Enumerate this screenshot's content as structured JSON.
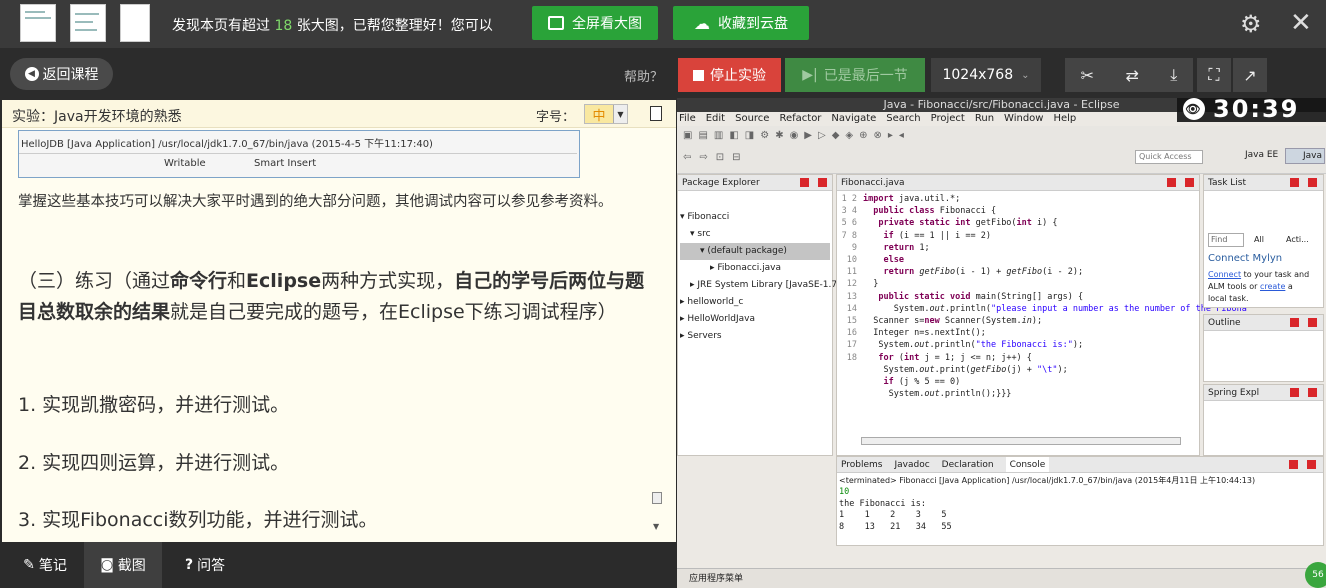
{
  "topbar": {
    "notice_pre": "发现本页有超过",
    "notice_num": "18",
    "notice_post": "张大图，已帮您整理好！您可以",
    "fullscreen_btn": "全屏看大图",
    "cloud_btn": "收藏到云盘"
  },
  "toolbar": {
    "back": "返回课程",
    "help": "帮助？",
    "stop": "停止实验",
    "last": "已是最后一节",
    "resolution": "1024x768"
  },
  "doc": {
    "title": "实验：Java开发环境的熟悉",
    "font_label": "字号：",
    "font_value": "中",
    "mini_console": "HelloJDB [Java Application] /usr/local/jdk1.7.0_67/bin/java (2015-4-5 下午11:17:40)",
    "mini_writable": "Writable",
    "mini_insert": "Smart Insert",
    "para1": "掌握这些基本技巧可以解决大家平时遇到的绝大部分问题，其他调试内容可以参见参考资料。",
    "h_a": "（三）练习（通过",
    "h_b": "命令行",
    "h_c": "和",
    "h_d": "Eclipse",
    "h_e": "两种方式实现，",
    "h_f": "自己的学号后两位与题目总数取余的结果",
    "h_g": "就是自己要完成的题号，在Eclipse下练习调试程序）",
    "item1": "1. 实现凯撒密码，并进行测试。",
    "item2": "2. 实现四则运算，并进行测试。",
    "item3": "3. 实现Fibonacci数列功能，并进行测试。"
  },
  "bottom_tabs": {
    "notes": "笔记",
    "screenshot": "截图",
    "qa": "问答"
  },
  "eclipse": {
    "title": "Java - Fibonacci/src/Fibonacci.java - Eclipse",
    "timer": "30:39",
    "menu": [
      "File",
      "Edit",
      "Source",
      "Refactor",
      "Navigate",
      "Search",
      "Project",
      "Run",
      "Window",
      "Help"
    ],
    "quick_access": "Quick Access",
    "persp_ee": "Java EE",
    "persp_java": "Java",
    "pkg_explorer": "Package Explorer",
    "tree": [
      "Fibonacci",
      "src",
      "(default package)",
      "Fibonacci.java",
      "JRE System Library [JavaSE-1.7]",
      "helloworld_c",
      "HelloWorldJava",
      "Servers"
    ],
    "editor_tab": "Fibonacci.java",
    "task_list": "Task List",
    "find": "Find",
    "all": "All",
    "acti": "Acti...",
    "mylyn_title": "Connect Mylyn",
    "mylyn_connect": "Connect",
    "mylyn_text1": " to your task and",
    "mylyn_text2": "ALM tools or ",
    "mylyn_create": "create",
    "mylyn_text3": " a",
    "mylyn_text4": "local task.",
    "outline": "Outline",
    "spring": "Spring Expl",
    "bottom_tabs": [
      "Problems",
      "Javadoc",
      "Declaration",
      "Console"
    ],
    "console_header": "<terminated> Fibonacci [Java Application] /usr/local/jdk1.7.0_67/bin/java (2015年4月11日 上午10:44:13)",
    "console_input": "10",
    "console_l1": "the Fibonacci is:",
    "console_l2": "1    1    2    3    5",
    "console_l3": "8    13   21   34   55",
    "status": "应用程序菜单",
    "badge": "56"
  }
}
